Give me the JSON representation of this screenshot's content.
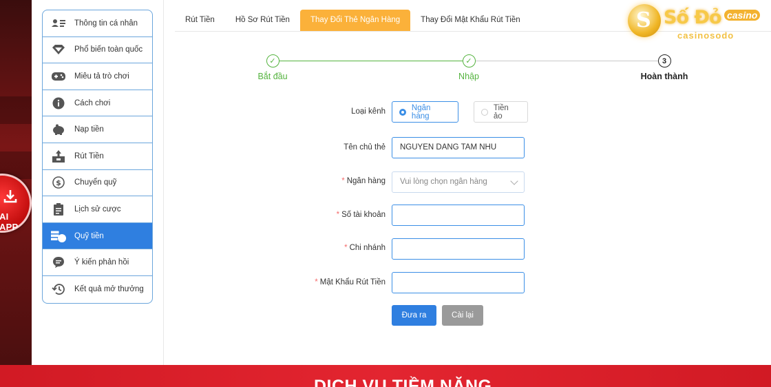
{
  "app_badge": {
    "label": "AI APP"
  },
  "sidebar": {
    "items": [
      {
        "label": "Thông tin cá nhân",
        "icon": "id-card-icon",
        "active": false
      },
      {
        "label": "Phổ biến toàn quốc",
        "icon": "diamond-icon",
        "active": false
      },
      {
        "label": "Miêu tả trò chơi",
        "icon": "gamepad-icon",
        "active": false
      },
      {
        "label": "Cách chơi",
        "icon": "info-icon",
        "active": false
      },
      {
        "label": "Nạp tiền",
        "icon": "piggy-bank-icon",
        "active": false
      },
      {
        "label": "Rút Tiền",
        "icon": "withdraw-icon",
        "active": false
      },
      {
        "label": "Chuyển quỹ",
        "icon": "dollar-circle-icon",
        "active": false
      },
      {
        "label": "Lịch sử cược",
        "icon": "clipboard-icon",
        "active": false
      },
      {
        "label": "Quỹ tiền",
        "icon": "fund-icon",
        "active": true
      },
      {
        "label": "Ý kiến phản hồi",
        "icon": "chat-bubble-icon",
        "active": false
      },
      {
        "label": "Kết quả mở thưởng",
        "icon": "history-icon",
        "active": false
      }
    ]
  },
  "tabs": [
    {
      "label": "Rút Tiền",
      "active": false
    },
    {
      "label": "Hồ Sơ Rút Tiền",
      "active": false
    },
    {
      "label": "Thay Đổi Thẻ Ngân Hàng",
      "active": true
    },
    {
      "label": "Thay Đổi Mật Khẩu Rút Tiền",
      "active": false
    }
  ],
  "logo": {
    "name": "Số Đỏ",
    "badge": "casino",
    "sub": "casinosodo"
  },
  "steps": [
    {
      "label": "Bắt đầu",
      "state": "done",
      "number": "✓"
    },
    {
      "label": "Nhập",
      "state": "done",
      "number": "✓"
    },
    {
      "label": "Hoàn thành",
      "state": "current",
      "number": "3"
    }
  ],
  "form": {
    "channel_label": "Loại kênh",
    "channel_options": [
      "Ngân hàng",
      "Tiền ảo"
    ],
    "channel_selected": "Ngân hàng",
    "holder_label": "Tên chủ thẻ",
    "holder_value": "NGUYEN DANG TAM NHU",
    "bank_label": "Ngân hàng",
    "bank_placeholder": "Vui lòng chọn ngân hàng",
    "account_label": "Số tài khoản",
    "account_value": "",
    "branch_label": "Chi nhánh",
    "branch_value": "",
    "password_label": "Mật Khẩu Rút Tiền",
    "password_value": "",
    "required_mark": "*"
  },
  "buttons": {
    "submit": "Đưa ra",
    "reset": "Cài lại"
  },
  "banner": {
    "title": "DỊCH VỤ TIỀM NĂNG"
  },
  "colors": {
    "accent": "#2f7fe0",
    "tab_active": "#fbb13a",
    "step_done": "#54b33e",
    "banner": "#e32530"
  }
}
